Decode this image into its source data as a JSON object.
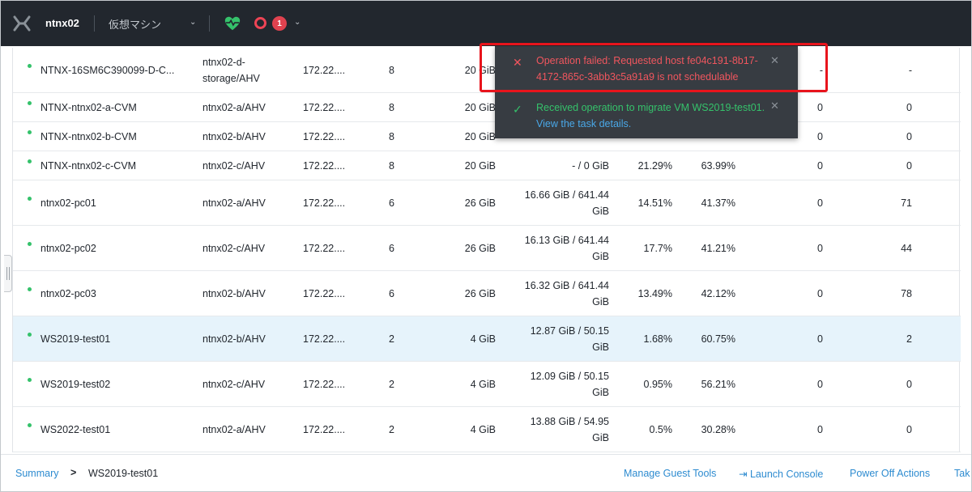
{
  "topbar": {
    "cluster_name": "ntnx02",
    "entity_label": "仮想マシン",
    "alert_count": "1",
    "colors": {
      "bar": "#22272e",
      "health": "#35c26b",
      "alert": "#e0424f"
    }
  },
  "icons": {
    "logo": "nutanix-x-logo",
    "entity_dropdown": "chevron-down-icon",
    "health": "heart-pulse-icon",
    "alert": "alert-ring-icon",
    "alert_dropdown": "chevron-down-icon"
  },
  "table": {
    "rows": [
      {
        "name": "NTNX-16SM6C390099-D-C...",
        "host": "ntnx02-d-storage/AHV",
        "ip": "172.22....",
        "cores": "8",
        "memory": "20 GiB",
        "storage": "",
        "cpu": "",
        "mem_usage": "",
        "iops": "-",
        "latency": "-"
      },
      {
        "name": "NTNX-ntnx02-a-CVM",
        "host": "ntnx02-a/AHV",
        "ip": "172.22....",
        "cores": "8",
        "memory": "20 GiB",
        "storage": "",
        "cpu": "",
        "mem_usage": "",
        "iops": "0",
        "latency": "0"
      },
      {
        "name": "NTNX-ntnx02-b-CVM",
        "host": "ntnx02-b/AHV",
        "ip": "172.22....",
        "cores": "8",
        "memory": "20 GiB",
        "storage": "",
        "cpu": "",
        "mem_usage": "",
        "iops": "0",
        "latency": "0"
      },
      {
        "name": "NTNX-ntnx02-c-CVM",
        "host": "ntnx02-c/AHV",
        "ip": "172.22....",
        "cores": "8",
        "memory": "20 GiB",
        "storage": "- / 0 GiB",
        "cpu": "21.29%",
        "mem_usage": "63.99%",
        "iops": "0",
        "latency": "0"
      },
      {
        "name": "ntnx02-pc01",
        "host": "ntnx02-a/AHV",
        "ip": "172.22....",
        "cores": "6",
        "memory": "26 GiB",
        "storage": "16.66 GiB / 641.44 GiB",
        "cpu": "14.51%",
        "mem_usage": "41.37%",
        "iops": "0",
        "latency": "71"
      },
      {
        "name": "ntnx02-pc02",
        "host": "ntnx02-c/AHV",
        "ip": "172.22....",
        "cores": "6",
        "memory": "26 GiB",
        "storage": "16.13 GiB / 641.44 GiB",
        "cpu": "17.7%",
        "mem_usage": "41.21%",
        "iops": "0",
        "latency": "44"
      },
      {
        "name": "ntnx02-pc03",
        "host": "ntnx02-b/AHV",
        "ip": "172.22....",
        "cores": "6",
        "memory": "26 GiB",
        "storage": "16.32 GiB / 641.44 GiB",
        "cpu": "13.49%",
        "mem_usage": "42.12%",
        "iops": "0",
        "latency": "78"
      },
      {
        "name": "WS2019-test01",
        "host": "ntnx02-b/AHV",
        "ip": "172.22....",
        "cores": "2",
        "memory": "4 GiB",
        "storage": "12.87 GiB / 50.15 GiB",
        "cpu": "1.68%",
        "mem_usage": "60.75%",
        "iops": "0",
        "latency": "2"
      },
      {
        "name": "WS2019-test02",
        "host": "ntnx02-c/AHV",
        "ip": "172.22....",
        "cores": "2",
        "memory": "4 GiB",
        "storage": "12.09 GiB / 50.15 GiB",
        "cpu": "0.95%",
        "mem_usage": "56.21%",
        "iops": "0",
        "latency": "0"
      },
      {
        "name": "WS2022-test01",
        "host": "ntnx02-a/AHV",
        "ip": "172.22....",
        "cores": "2",
        "memory": "4 GiB",
        "storage": "13.88 GiB / 54.95 GiB",
        "cpu": "0.5%",
        "mem_usage": "30.28%",
        "iops": "0",
        "latency": "0"
      }
    ],
    "selected_row": "WS2019-test01",
    "status_color": "#35c26b"
  },
  "notifications": [
    {
      "type": "error",
      "icon": "error-x-icon",
      "message": "Operation failed: Requested host fe04c191-8b17-4172-865c-3abb3c5a91a9 is not schedulable",
      "link": "",
      "color": "#f0565e"
    },
    {
      "type": "success",
      "icon": "check-icon",
      "message": "Received operation to migrate VM WS2019-test01.",
      "link": "View the task details.",
      "color": "#35c26b"
    }
  ],
  "footer": {
    "breadcrumb_link": "Summary",
    "breadcrumb_sep": ">",
    "breadcrumb_current": "WS2019-test01",
    "actions": {
      "manage_guest_tools": "Manage Guest Tools",
      "launch_console_icon": "⇥",
      "launch_console": "Launch Console",
      "power_off_actions": "Power Off Actions",
      "take": "Tak"
    }
  }
}
